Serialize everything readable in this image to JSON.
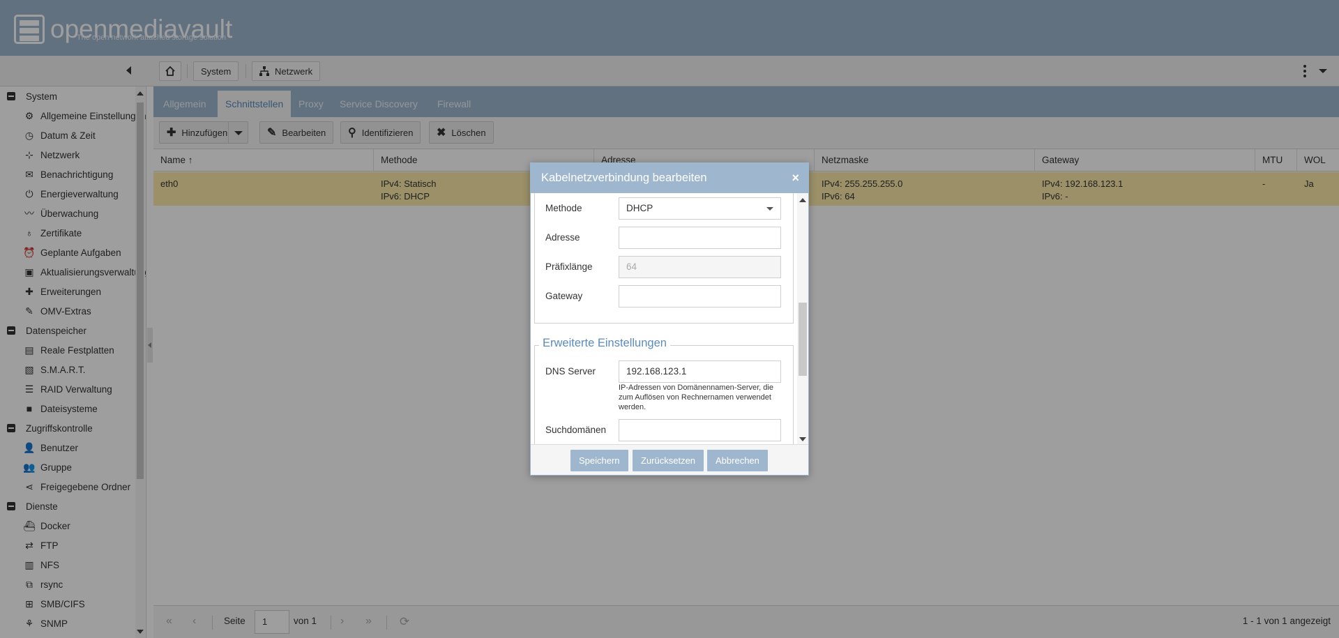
{
  "app": {
    "logo_text": "openmediavault",
    "logo_sub": "The open network attached storage solution"
  },
  "breadcrumb": [
    {
      "label": "System",
      "icon": "home-icon"
    },
    {
      "label": "Netzwerk",
      "icon": "network-icon"
    }
  ],
  "sidebar": {
    "groups": [
      {
        "label": "System",
        "items": [
          "Allgemeine Einstellungen",
          "Datum & Zeit",
          "Netzwerk",
          "Benachrichtigung",
          "Energieverwaltung",
          "Überwachung",
          "Zertifikate",
          "Geplante Aufgaben",
          "Aktualisierungsverwaltung",
          "Erweiterungen",
          "OMV-Extras"
        ]
      },
      {
        "label": "Datenspeicher",
        "items": [
          "Reale Festplatten",
          "S.M.A.R.T.",
          "RAID Verwaltung",
          "Dateisysteme"
        ]
      },
      {
        "label": "Zugriffskontrolle",
        "items": [
          "Benutzer",
          "Gruppe",
          "Freigegebene Ordner"
        ]
      },
      {
        "label": "Dienste",
        "items": [
          "Docker",
          "FTP",
          "NFS",
          "rsync",
          "SMB/CIFS",
          "SNMP"
        ]
      }
    ]
  },
  "tabs": [
    "Allgemein",
    "Schnittstellen",
    "Proxy",
    "Service Discovery",
    "Firewall"
  ],
  "active_tab": "Schnittstellen",
  "actions": {
    "add": "Hinzufügen",
    "edit": "Bearbeiten",
    "identify": "Identifizieren",
    "delete": "Löschen"
  },
  "grid": {
    "columns": [
      "Name",
      "Methode",
      "Adresse",
      "Netzmaske",
      "Gateway",
      "MTU",
      "WOL"
    ],
    "row": {
      "name": "eth0",
      "method_v4": "IPv4: Statisch",
      "method_v6": "IPv6: DHCP",
      "netmask_v4": "IPv4: 255.255.255.0",
      "netmask_v6": "IPv6: 64",
      "gateway_v4": "IPv4: 192.168.123.1",
      "gateway_v6": "IPv6: -",
      "mtu": "-",
      "wol": "Ja"
    }
  },
  "pager": {
    "page_label": "Seite",
    "page": "1",
    "of_label": "von 1",
    "summary": "1 - 1 von 1 angezeigt"
  },
  "dialog": {
    "title": "Kabelnetzverbindung bearbeiten",
    "close": "×",
    "fields": {
      "method_label": "Methode",
      "method_value": "DHCP",
      "address_label": "Adresse",
      "address_value": "",
      "prefix_label": "Präfixlänge",
      "prefix_placeholder": "64",
      "gateway_label": "Gateway",
      "gateway_value": ""
    },
    "advanced": {
      "legend": "Erweiterte Einstellungen",
      "dns_label": "DNS Server",
      "dns_value": "192.168.123.1",
      "dns_help": "IP-Adressen von Domänennamen-Server, die zum Auflösen von Rechnernamen verwendet werden.",
      "search_label": "Suchdomänen",
      "search_value": ""
    },
    "buttons": {
      "save": "Speichern",
      "reset": "Zurücksetzen",
      "cancel": "Abbrechen"
    }
  },
  "colors": {
    "header": "#9fb6cf",
    "selected_row": "#fbe9a9",
    "accent_text": "#5a8bbd"
  }
}
